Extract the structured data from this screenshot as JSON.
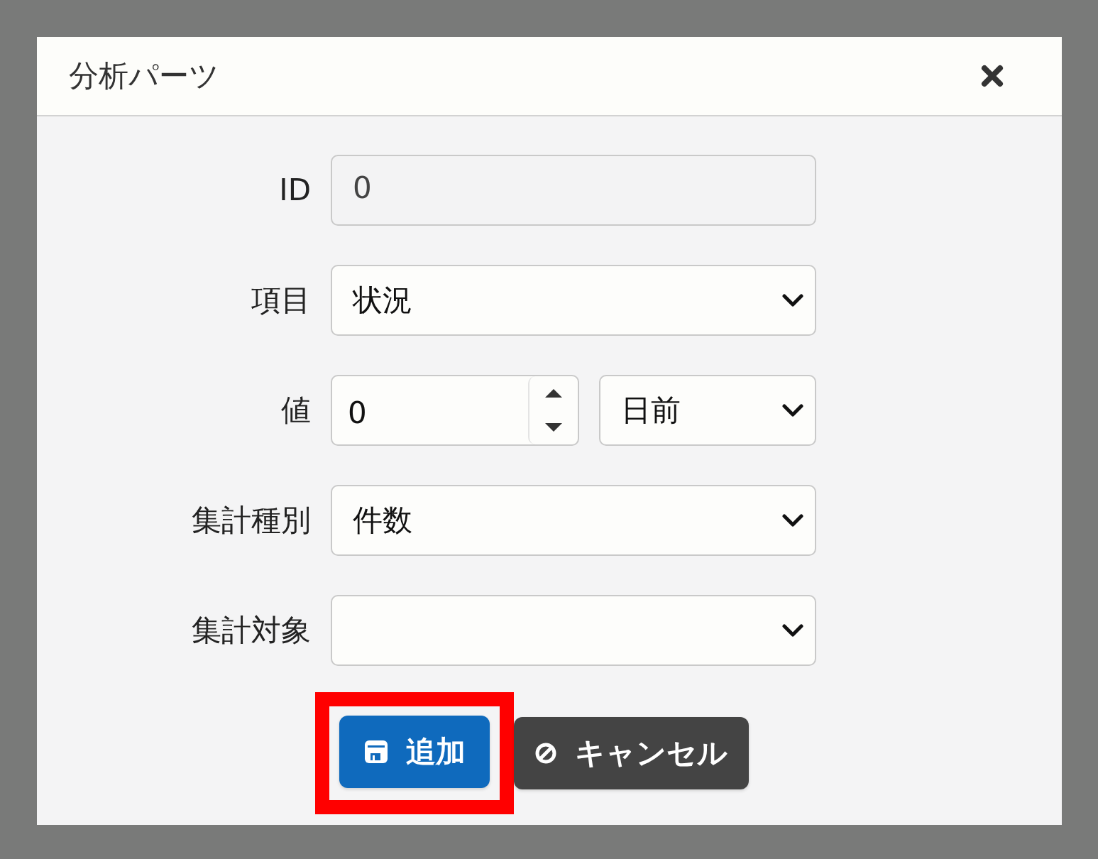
{
  "dialog": {
    "title": "分析パーツ"
  },
  "fields": [
    {
      "label": "ID",
      "kind": "text",
      "value": "0",
      "disabled": true
    },
    {
      "label": "項目",
      "kind": "select",
      "value": "状況",
      "disabled": false
    },
    {
      "label": "値",
      "kind": "number",
      "value": "0",
      "unit": {
        "value": "日前"
      },
      "disabled": false
    },
    {
      "label": "集計種別",
      "kind": "select",
      "value": "件数",
      "disabled": false
    },
    {
      "label": "集計対象",
      "kind": "select",
      "disabled": false
    }
  ],
  "buttons": [
    {
      "label": "追加",
      "kind": "primary",
      "highlighted": true
    },
    {
      "label": "キャンセル",
      "kind": "secondary",
      "highlighted": false
    }
  ]
}
